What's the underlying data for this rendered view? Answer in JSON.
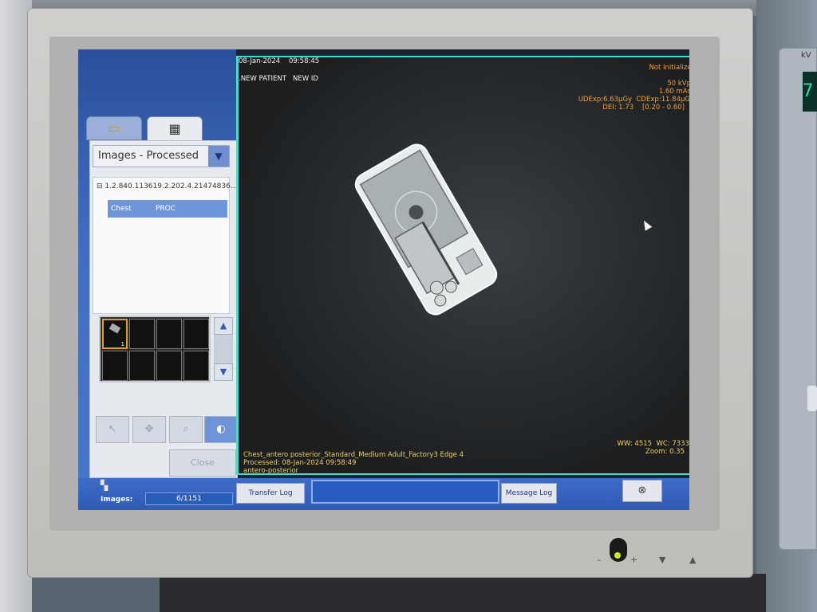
{
  "left_panel": {
    "tab_images_icon": "film-strip-icon",
    "tab_grid_icon": "grid-view-icon",
    "dropdown": {
      "value": "Images - Processed"
    },
    "tree": {
      "study_id": "1.2.840.113619.2.202.4.21474836...",
      "series": {
        "body_part": "Chest",
        "type": "PROC"
      }
    },
    "thumbnail_index": "1",
    "tools": [
      "select-icon",
      "pan-icon",
      "magnify-icon",
      "contrast-icon"
    ],
    "close_label": "Close"
  },
  "status_bar": {
    "images_label": "Images:",
    "images_value": "6/1151",
    "transfer_log": "Transfer Log",
    "message_log": "Message Log"
  },
  "viewer": {
    "date": "08-Jan-2024",
    "time": "09:58:45",
    "patient": ".NEW PATIENT",
    "patient_id": "NEW ID",
    "status": "Not Initialized",
    "kvp": "50 kVp",
    "mas": "1.60 mAs",
    "udexp": "UDExp:6.63µGy",
    "cdexp": "CDExp:11.84µGy",
    "dei": "DEI: 1.73",
    "dei_range": "[0.20 - 0.60]",
    "protocol": "Chest_antero posterior_Standard_Medium Adult_Factory3 Edge 4",
    "processed": "Processed: 08-Jan-2024  09:58:49",
    "view": "antero-posterior",
    "ww": "WW: 4515",
    "wc": "WC: 7333",
    "zoom": "Zoom: 0.35"
  },
  "colors": {
    "overlay_orange": "#f0a040",
    "overlay_yellow": "#f2d060",
    "viewer_border": "#4bd9d0",
    "ui_blue": "#3d6cc8"
  }
}
